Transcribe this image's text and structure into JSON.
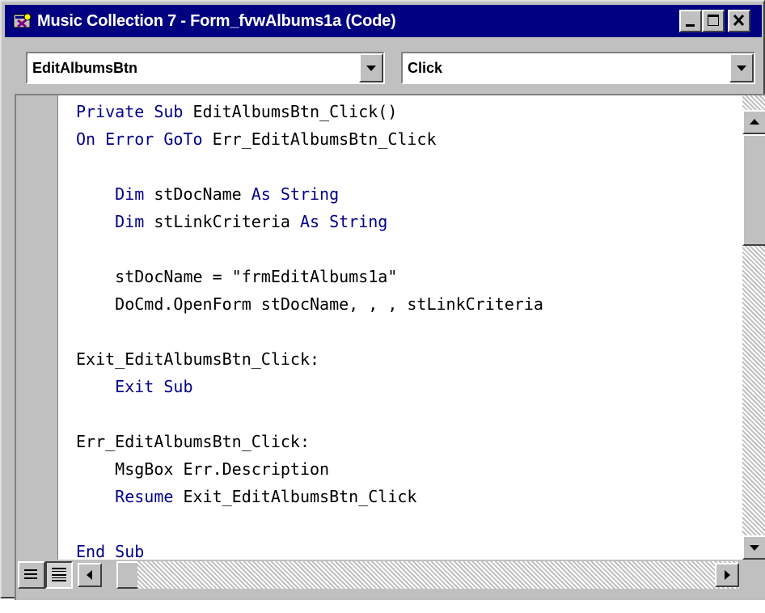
{
  "window": {
    "title": "Music Collection 7 - Form_fvwAlbums1a (Code)",
    "icon": "access-form-code-icon",
    "controls": [
      "minimize-icon",
      "maximize-icon",
      "close-icon"
    ]
  },
  "object_combo": {
    "value": "EditAlbumsBtn"
  },
  "procedure_combo": {
    "value": "Click"
  },
  "code": {
    "lines": [
      [
        {
          "t": "kw",
          "s": "Private Sub "
        },
        {
          "t": "tx",
          "s": "EditAlbumsBtn_Click()"
        }
      ],
      [
        {
          "t": "kw",
          "s": "On Error GoTo "
        },
        {
          "t": "tx",
          "s": "Err_EditAlbumsBtn_Click"
        }
      ],
      [],
      [
        {
          "t": "kw",
          "s": "    Dim "
        },
        {
          "t": "tx",
          "s": "stDocName "
        },
        {
          "t": "kw",
          "s": "As String"
        }
      ],
      [
        {
          "t": "kw",
          "s": "    Dim "
        },
        {
          "t": "tx",
          "s": "stLinkCriteria "
        },
        {
          "t": "kw",
          "s": "As String"
        }
      ],
      [],
      [
        {
          "t": "tx",
          "s": "    stDocName = \"frmEditAlbums1a\""
        }
      ],
      [
        {
          "t": "tx",
          "s": "    DoCmd.OpenForm stDocName, , , stLinkCriteria"
        }
      ],
      [],
      [
        {
          "t": "tx",
          "s": "Exit_EditAlbumsBtn_Click:"
        }
      ],
      [
        {
          "t": "kw",
          "s": "    Exit Sub"
        }
      ],
      [],
      [
        {
          "t": "tx",
          "s": "Err_EditAlbumsBtn_Click:"
        }
      ],
      [
        {
          "t": "tx",
          "s": "    MsgBox Err.Description"
        }
      ],
      [
        {
          "t": "kw",
          "s": "    Resume "
        },
        {
          "t": "tx",
          "s": "Exit_EditAlbumsBtn_Click"
        }
      ],
      [],
      [
        {
          "t": "kw",
          "s": "End Sub"
        }
      ]
    ]
  },
  "colors": {
    "keyword": "#00008b",
    "text": "#000000",
    "titlebar": "#000080",
    "chrome": "#c0c0c0"
  }
}
